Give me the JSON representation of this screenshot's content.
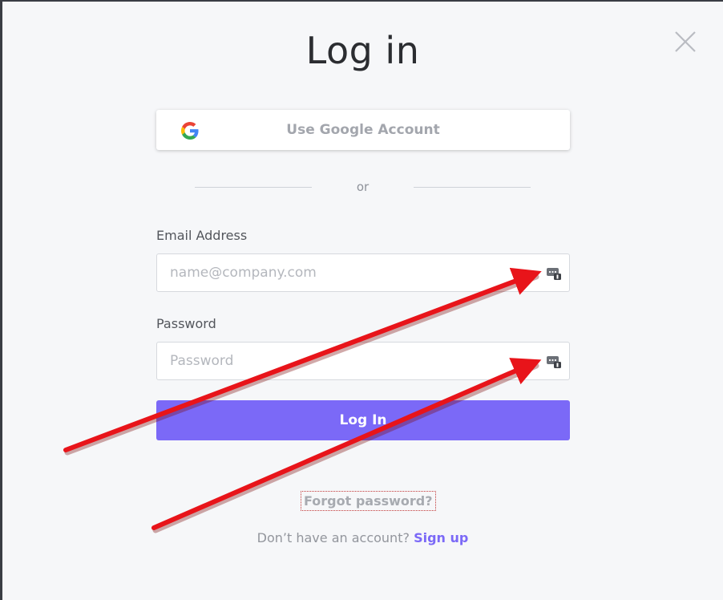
{
  "modal": {
    "title": "Log in",
    "close_icon": "close-x-icon"
  },
  "google": {
    "label": "Use Google Account",
    "icon": "google-g-icon"
  },
  "divider": {
    "text": "or"
  },
  "email": {
    "label": "Email Address",
    "placeholder": "name@company.com",
    "value": "",
    "manager_icon": "password-manager-icon"
  },
  "password": {
    "label": "Password",
    "placeholder": "Password",
    "value": "",
    "manager_icon": "password-manager-icon"
  },
  "login_button": {
    "label": "Log In"
  },
  "forgot": {
    "label": "Forgot password?"
  },
  "signup": {
    "prompt": "Don’t have an account?",
    "link": "Sign up"
  },
  "colors": {
    "accent": "#7b69f7",
    "background": "#f6f7f9",
    "annotation_arrow": "#e8141a"
  }
}
